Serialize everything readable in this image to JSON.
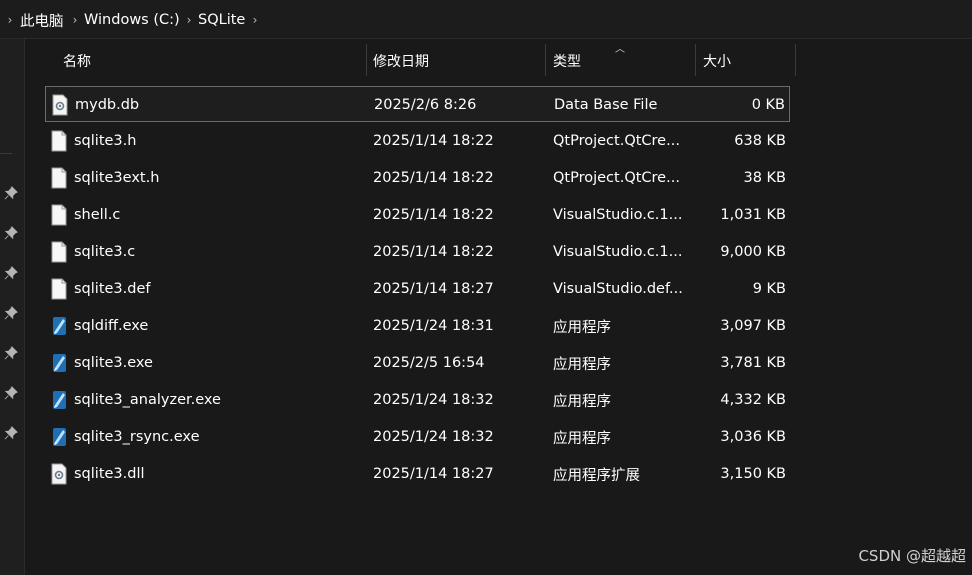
{
  "breadcrumb": {
    "items": [
      "此电脑",
      "Windows (C:)",
      "SQLite"
    ]
  },
  "columns": {
    "name": "名称",
    "date": "修改日期",
    "type": "类型",
    "size": "大小"
  },
  "files": [
    {
      "name": "mydb.db",
      "date": "2025/2/6 8:26",
      "type": "Data Base File",
      "size": "0 KB",
      "icon": "settings-file-icon"
    },
    {
      "name": "sqlite3.h",
      "date": "2025/1/14 18:22",
      "type": "QtProject.QtCre...",
      "size": "638 KB",
      "icon": "document-icon"
    },
    {
      "name": "sqlite3ext.h",
      "date": "2025/1/14 18:22",
      "type": "QtProject.QtCre...",
      "size": "38 KB",
      "icon": "document-icon"
    },
    {
      "name": "shell.c",
      "date": "2025/1/14 18:22",
      "type": "VisualStudio.c.1...",
      "size": "1,031 KB",
      "icon": "document-icon"
    },
    {
      "name": "sqlite3.c",
      "date": "2025/1/14 18:22",
      "type": "VisualStudio.c.1...",
      "size": "9,000 KB",
      "icon": "document-icon"
    },
    {
      "name": "sqlite3.def",
      "date": "2025/1/14 18:27",
      "type": "VisualStudio.def...",
      "size": "9 KB",
      "icon": "document-icon"
    },
    {
      "name": "sqldiff.exe",
      "date": "2025/1/24 18:31",
      "type": "应用程序",
      "size": "3,097 KB",
      "icon": "sqlite-exe-icon"
    },
    {
      "name": "sqlite3.exe",
      "date": "2025/2/5 16:54",
      "type": "应用程序",
      "size": "3,781 KB",
      "icon": "sqlite-exe-icon"
    },
    {
      "name": "sqlite3_analyzer.exe",
      "date": "2025/1/24 18:32",
      "type": "应用程序",
      "size": "4,332 KB",
      "icon": "sqlite-exe-icon"
    },
    {
      "name": "sqlite3_rsync.exe",
      "date": "2025/1/24 18:32",
      "type": "应用程序",
      "size": "3,036 KB",
      "icon": "sqlite-exe-icon"
    },
    {
      "name": "sqlite3.dll",
      "date": "2025/1/14 18:27",
      "type": "应用程序扩展",
      "size": "3,150 KB",
      "icon": "settings-file-icon"
    }
  ],
  "watermark": "CSDN @超越超"
}
